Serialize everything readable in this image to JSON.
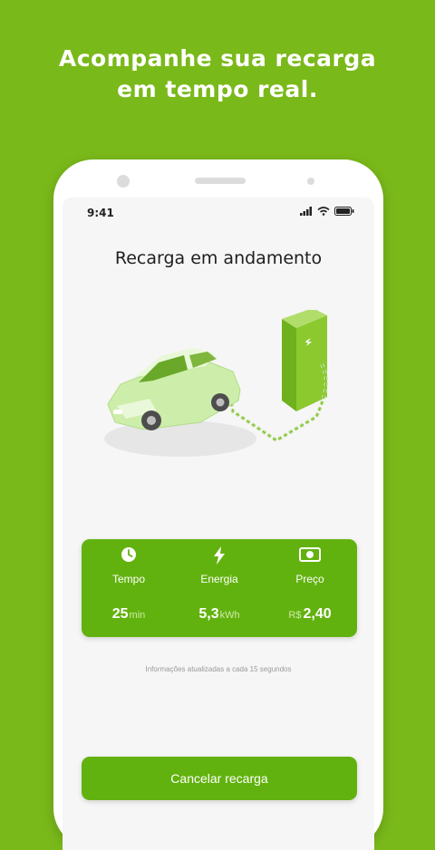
{
  "promo": {
    "line1": "Acompanhe sua recarga",
    "line2": "em tempo real."
  },
  "status_bar": {
    "time": "9:41",
    "icons": [
      "signal-icon",
      "wifi-icon",
      "battery-icon"
    ]
  },
  "screen": {
    "title": "Recarga em andamento",
    "illustration": "car-charging-illustration"
  },
  "stats": [
    {
      "icon": "clock-icon",
      "label": "Tempo",
      "value": "25",
      "unit": "min"
    },
    {
      "icon": "lightning-icon",
      "label": "Energia",
      "value": "5,3",
      "unit": "kWh"
    },
    {
      "icon": "cash-icon",
      "label": "Preço",
      "currency": "R$",
      "value": "2,40"
    }
  ],
  "note": "Informações atualizadas a cada 15 segundos",
  "actions": {
    "cancel_label": "Cancelar recarga"
  },
  "colors": {
    "background": "#7ab91a",
    "accent": "#62b20f",
    "screen_bg": "#f6f6f6",
    "title_text": "#1e1e1e"
  }
}
